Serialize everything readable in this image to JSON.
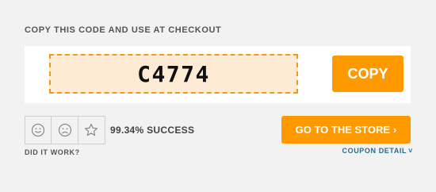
{
  "instruction": "COPY THIS CODE AND USE AT CHECKOUT",
  "coupon": {
    "code": "C4774",
    "copy_label": "COPY"
  },
  "feedback": {
    "buttons": [
      {
        "icon": "smile-icon"
      },
      {
        "icon": "frown-icon"
      },
      {
        "icon": "star-icon"
      }
    ],
    "success_rate": "99.34% SUCCESS",
    "question": "DID IT WORK?"
  },
  "store_button": {
    "label": "GO TO THE STORE",
    "arrow": "›"
  },
  "coupon_detail": {
    "label": "COUPON DETAIL",
    "chevron": "˅"
  },
  "colors": {
    "accent": "#ff9900",
    "code_bg": "#fdebd6",
    "code_border": "#f29a16",
    "link": "#2b6a8f",
    "page_bg": "#f2f2f2"
  }
}
